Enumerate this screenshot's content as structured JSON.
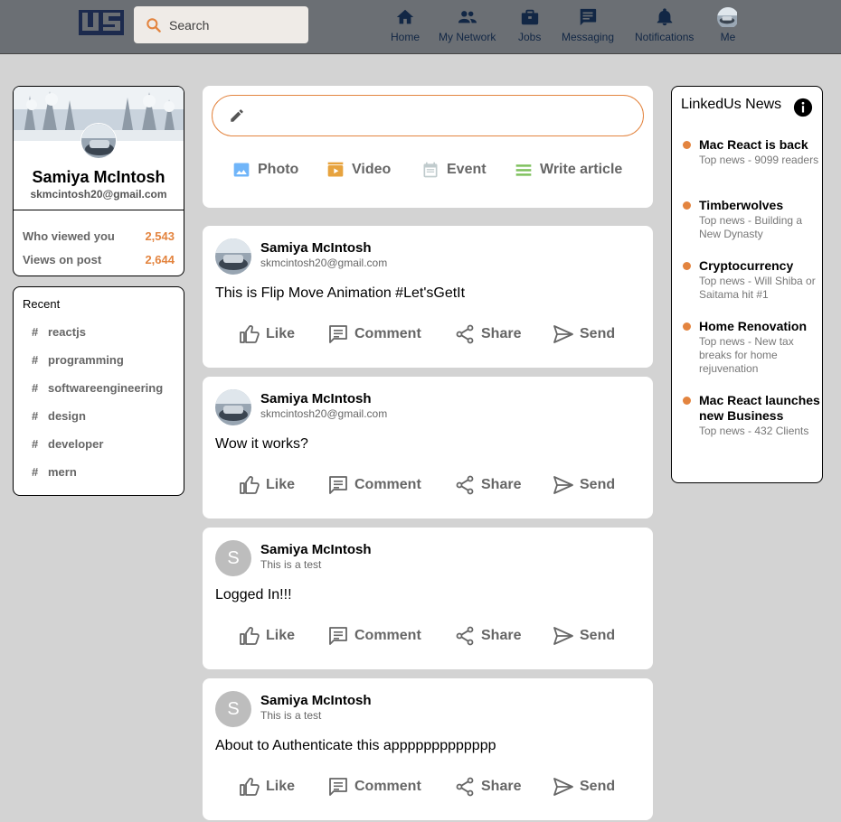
{
  "header": {
    "search_placeholder": "Search",
    "nav": [
      {
        "label": "Home",
        "icon": "home-icon"
      },
      {
        "label": "My Network",
        "icon": "people-icon"
      },
      {
        "label": "Jobs",
        "icon": "briefcase-icon"
      },
      {
        "label": "Messaging",
        "icon": "chat-icon"
      },
      {
        "label": "Notifications",
        "icon": "bell-icon"
      },
      {
        "label": "Me",
        "icon": "avatar"
      }
    ]
  },
  "profile": {
    "name": "Samiya McIntosh",
    "email": "skmcintosh20@gmail.com",
    "stats": [
      {
        "label": "Who viewed you",
        "value": "2,543"
      },
      {
        "label": "Views on post",
        "value": "2,644"
      }
    ]
  },
  "recent": {
    "title": "Recent",
    "tags": [
      "reactjs",
      "programming",
      "softwareengineering",
      "design",
      "developer",
      "mern"
    ]
  },
  "composer": {
    "options": [
      {
        "label": "Photo",
        "icon": "photo-icon",
        "color": "#70b5f9"
      },
      {
        "label": "Video",
        "icon": "video-icon",
        "color": "#e7a33e"
      },
      {
        "label": "Event",
        "icon": "calendar-icon",
        "color": "#c0cbcd"
      },
      {
        "label": "Write article",
        "icon": "article-icon",
        "color": "#7fc15e"
      }
    ]
  },
  "posts": [
    {
      "name": "Samiya McIntosh",
      "sub": "skmcintosh20@gmail.com",
      "message": "This is Flip Move Animation #Let'sGetIt",
      "avatar": "photo"
    },
    {
      "name": "Samiya McIntosh",
      "sub": "skmcintosh20@gmail.com",
      "message": "Wow it works?",
      "avatar": "photo"
    },
    {
      "name": "Samiya McIntosh",
      "sub": "This is a test",
      "message": "Logged In!!!",
      "avatar": "S"
    },
    {
      "name": "Samiya McIntosh",
      "sub": "This is a test",
      "message": "About to Authenticate this appppppppppppp",
      "avatar": "S"
    }
  ],
  "post_actions": [
    "Like",
    "Comment",
    "Share",
    "Send"
  ],
  "news": {
    "title": "LinkedUs News",
    "items": [
      {
        "heading": "Mac React is back",
        "sub": "Top news - 9099 readers"
      },
      {
        "heading": "Timberwolves",
        "sub": "Top news - Building a New Dynasty"
      },
      {
        "heading": "Cryptocurrency",
        "sub": "Top news - Will Shiba or Saitama hit #1"
      },
      {
        "heading": "Home Renovation",
        "sub": "Top news - New tax breaks for home rejuvenation"
      },
      {
        "heading": "Mac React launches new Business",
        "sub": "Top news - 432 Clients"
      }
    ]
  },
  "colors": {
    "accent": "#e3843f",
    "header_bg": "#6b6f74",
    "nav_text": "#122745",
    "page_bg": "#d3d3d3"
  }
}
